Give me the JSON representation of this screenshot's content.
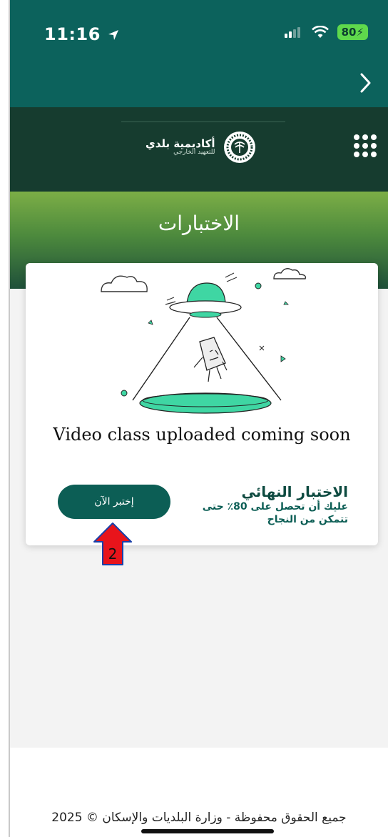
{
  "status": {
    "time": "11:16",
    "battery": "80"
  },
  "academy": {
    "name": "أكاديمية بلدي",
    "subtitle": "للتعهيد الخارجي"
  },
  "hero": {
    "title": "الاختبارات"
  },
  "card": {
    "message": "Video class uploaded coming soon",
    "exam_title": "الاختبار النهائي",
    "exam_desc_line1": "عليك أن تحصل على 80٪ حتى",
    "exam_desc_line2": "تتمكن من النجاح",
    "start_label": "إختبر الآن"
  },
  "annotation": {
    "number": "2"
  },
  "footer": {
    "copyright": "جميع الحقوق محفوظة - وزارة البلديات والإسكان © 2025"
  },
  "colors": {
    "primary": "#0c625c",
    "dark_header": "#163c2f",
    "accent_green": "#3fd6a3",
    "annotation_red": "#e8141b"
  }
}
